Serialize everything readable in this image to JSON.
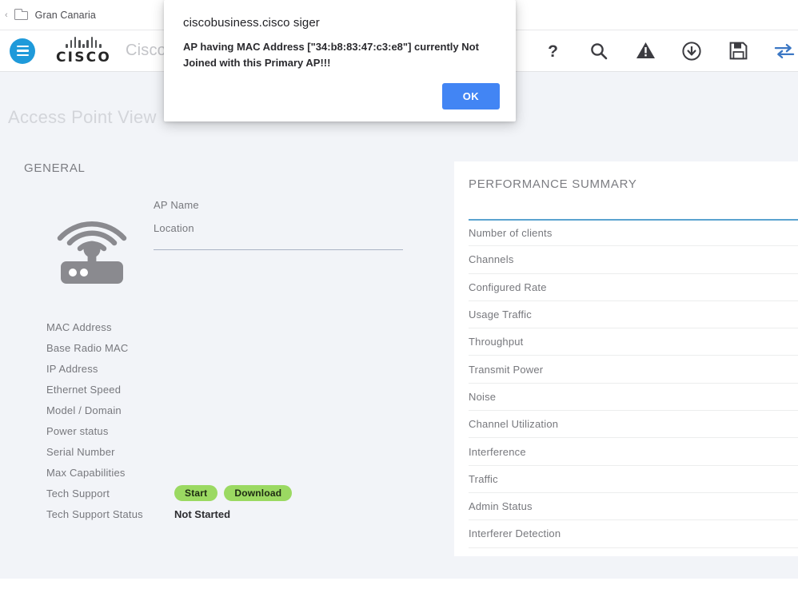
{
  "breadcrumb": {
    "back_chevron": "‹",
    "folder_icon": "folder-icon",
    "label": "Gran Canaria"
  },
  "header": {
    "menu_icon": "hamburger-menu-icon",
    "brand": "CISCO",
    "app_title": "Cisco",
    "icons": [
      {
        "name": "help-icon",
        "glyph": "?"
      },
      {
        "name": "search-icon",
        "glyph": "search"
      },
      {
        "name": "alert-icon",
        "glyph": "warning"
      },
      {
        "name": "download-icon",
        "glyph": "download"
      },
      {
        "name": "save-icon",
        "glyph": "floppy"
      },
      {
        "name": "swap-icon",
        "glyph": "swap"
      }
    ]
  },
  "page": {
    "title": "Access Point View",
    "background": "#f2f4f8"
  },
  "general": {
    "heading": "GENERAL",
    "ap_icon": "access-point-icon",
    "fields": [
      {
        "label": "AP Name",
        "value": ""
      },
      {
        "label": "Location",
        "value": ""
      }
    ],
    "rows": [
      {
        "label": "MAC Address",
        "value": ""
      },
      {
        "label": "Base Radio MAC",
        "value": ""
      },
      {
        "label": "IP Address",
        "value": ""
      },
      {
        "label": "Ethernet Speed",
        "value": ""
      },
      {
        "label": "Model / Domain",
        "value": ""
      },
      {
        "label": "Power status",
        "value": ""
      },
      {
        "label": "Serial Number",
        "value": ""
      },
      {
        "label": "Max Capabilities",
        "value": ""
      }
    ],
    "tech_support": {
      "label": "Tech Support",
      "start_button": "Start",
      "download_button": "Download",
      "button_color": "#9bd962"
    },
    "tech_support_status": {
      "label": "Tech Support Status",
      "value": "Not Started"
    }
  },
  "performance": {
    "heading": "PERFORMANCE SUMMARY",
    "watermark": "",
    "accent_color": "#5ba3d0",
    "rows": [
      {
        "label": "Number of clients",
        "value": ""
      },
      {
        "label": "Channels",
        "value": ""
      },
      {
        "label": "Configured Rate",
        "value": ""
      },
      {
        "label": "Usage Traffic",
        "value": ""
      },
      {
        "label": "Throughput",
        "value": ""
      },
      {
        "label": "Transmit Power",
        "value": ""
      },
      {
        "label": "Noise",
        "value": ""
      },
      {
        "label": "Channel Utilization",
        "value": ""
      },
      {
        "label": "Interference",
        "value": ""
      },
      {
        "label": "Traffic",
        "value": ""
      },
      {
        "label": "Admin Status",
        "value": ""
      },
      {
        "label": "Interferer Detection",
        "value": ""
      }
    ]
  },
  "dialog": {
    "title": "ciscobusiness.cisco siger",
    "message": "AP having MAC Address [\"34:b8:83:47:c3:e8\"] currently Not Joined with this Primary AP!!!",
    "ok_label": "OK",
    "ok_color": "#4285f4"
  }
}
